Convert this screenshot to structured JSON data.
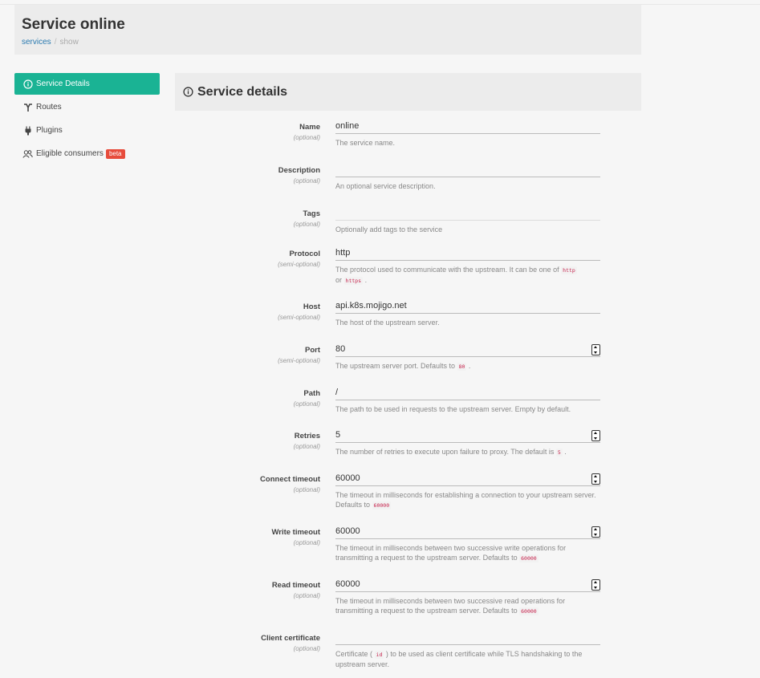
{
  "page": {
    "title": "Service online"
  },
  "breadcrumb": {
    "link": "services",
    "separator": "/",
    "current": "show"
  },
  "sidebar": {
    "items": [
      {
        "label": "Service Details",
        "icon": "info-circle-icon"
      },
      {
        "label": "Routes",
        "icon": "routes-icon"
      },
      {
        "label": "Plugins",
        "icon": "plug-icon"
      },
      {
        "label": "Eligible consumers",
        "icon": "users-icon",
        "badge": "beta"
      }
    ]
  },
  "panel": {
    "title": "Service details",
    "icon": "info-circle-icon"
  },
  "form": {
    "name": {
      "label": "Name",
      "optional": "(optional)",
      "value": "online",
      "help": "The service name."
    },
    "description": {
      "label": "Description",
      "optional": "(optional)",
      "value": "",
      "help": "An optional service description."
    },
    "tags": {
      "label": "Tags",
      "optional": "(optional)",
      "value": "",
      "help": "Optionally add tags to the service"
    },
    "protocol": {
      "label": "Protocol",
      "optional": "(semi-optional)",
      "value": "http",
      "help_pre": "The protocol used to communicate with the upstream. It can be one of",
      "code1": "http",
      "help_mid": "or",
      "code2": "https",
      "help_post": "."
    },
    "host": {
      "label": "Host",
      "optional": "(semi-optional)",
      "value": "api.k8s.mojigo.net",
      "help": "The host of the upstream server."
    },
    "port": {
      "label": "Port",
      "optional": "(semi-optional)",
      "value": "80",
      "help_pre": "The upstream server port. Defaults to",
      "code": "80",
      "help_post": "."
    },
    "path": {
      "label": "Path",
      "optional": "(optional)",
      "value": "/",
      "help": "The path to be used in requests to the upstream server. Empty by default."
    },
    "retries": {
      "label": "Retries",
      "optional": "(optional)",
      "value": "5",
      "help_pre": "The number of retries to execute upon failure to proxy. The default is",
      "code": "5",
      "help_post": "."
    },
    "connect_timeout": {
      "label": "Connect timeout",
      "optional": "(optional)",
      "value": "60000",
      "help_pre": "The timeout in milliseconds for establishing a connection to your upstream server. Defaults to",
      "code": "60000"
    },
    "write_timeout": {
      "label": "Write timeout",
      "optional": "(optional)",
      "value": "60000",
      "help_pre": "The timeout in milliseconds between two successive write operations for transmitting a request to the upstream server. Defaults to",
      "code": "60000"
    },
    "read_timeout": {
      "label": "Read timeout",
      "optional": "(optional)",
      "value": "60000",
      "help_pre": "The timeout in milliseconds between two successive read operations for transmitting a request to the upstream server. Defaults to",
      "code": "60000"
    },
    "client_certificate": {
      "label": "Client certificate",
      "optional": "(optional)",
      "value": "",
      "help_pre": "Certificate (",
      "code": "id",
      "help_post": ") to be used as client certificate while TLS handshaking to the upstream server."
    }
  },
  "colors": {
    "accent": "#1ab394",
    "badge": "#e74c3c",
    "link": "#2a7ab0",
    "code": "#c7254e"
  }
}
